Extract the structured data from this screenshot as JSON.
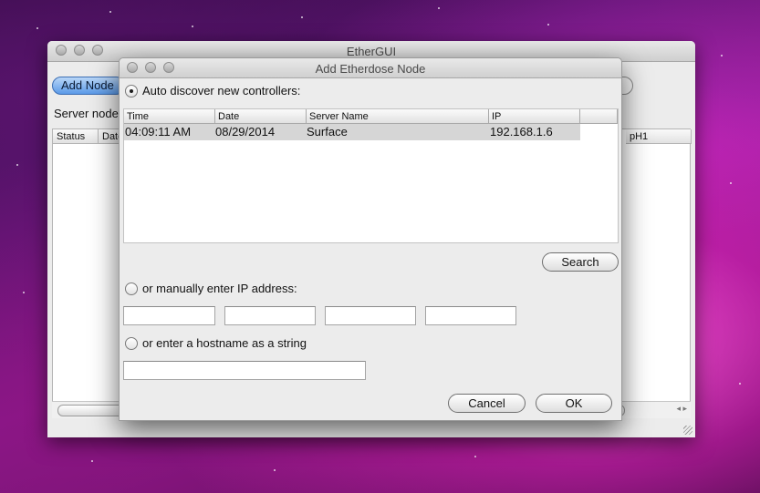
{
  "desktop": {},
  "back_window": {
    "title": "EtherGUI",
    "add_node_label": "Add Node",
    "server_nodes_label": "Server nodes",
    "table_headers": [
      "Status",
      "Date",
      "pH1"
    ]
  },
  "dialog": {
    "title": "Add Etherdose Node",
    "auto_discover_label": "Auto discover new controllers:",
    "auto_discover_selected": true,
    "columns": [
      "Time",
      "Date",
      "Server Name",
      "IP"
    ],
    "rows": [
      {
        "time": "04:09:11 AM",
        "date": "08/29/2014",
        "server_name": "Surface",
        "ip": "192.168.1.6"
      }
    ],
    "search_label": "Search",
    "manual_ip_label": "or manually enter IP address:",
    "ip_octets": [
      "",
      "",
      "",
      ""
    ],
    "hostname_label": "or enter a hostname as a string",
    "hostname_value": "",
    "cancel_label": "Cancel",
    "ok_label": "OK"
  }
}
